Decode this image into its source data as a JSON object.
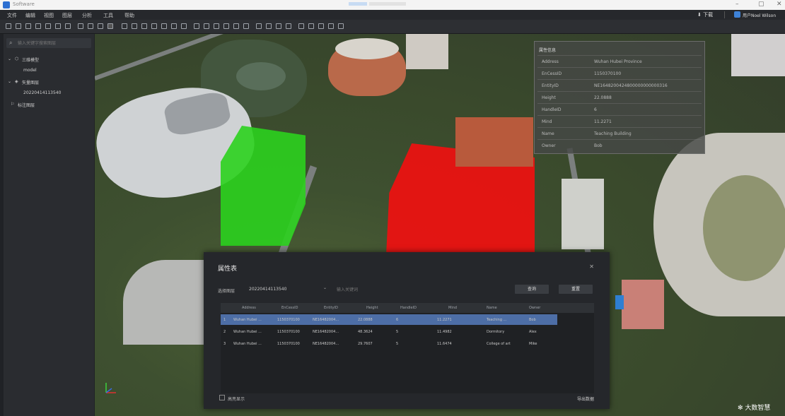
{
  "window": {
    "title": "Software"
  },
  "menu": {
    "items": [
      "文件",
      "编辑",
      "视图",
      "图层",
      "分析",
      "工具",
      "帮助"
    ],
    "right_label": "下载",
    "user": "用户Noel Wilson"
  },
  "sidebar": {
    "search_placeholder": "输入关键字搜索图层",
    "tree": [
      {
        "label": "三维模型",
        "level": 0
      },
      {
        "label": "model",
        "level": 1
      },
      {
        "label": "矢量图层",
        "level": 0
      },
      {
        "label": "20220414113540",
        "level": 1
      },
      {
        "label": "标注图层",
        "level": 0
      }
    ]
  },
  "info_popup": {
    "title": "属性信息",
    "rows": [
      {
        "key": "Address",
        "value": "Wuhan Hubei Province"
      },
      {
        "key": "EnCessID",
        "value": "1150370100"
      },
      {
        "key": "EntityID",
        "value": "NE1648200424800000000000316"
      },
      {
        "key": "Height",
        "value": "22.0888"
      },
      {
        "key": "HandleID",
        "value": "6"
      },
      {
        "key": "Mind",
        "value": "11.2271"
      },
      {
        "key": "Name",
        "value": "Teaching Building"
      },
      {
        "key": "Owner",
        "value": "Bob"
      }
    ]
  },
  "dialog": {
    "title": "属性表",
    "close": "✕",
    "filter_label": "选择图层",
    "filter_value": "20220414113540",
    "search_placeholder": "输入关键词",
    "btn_query": "查询",
    "btn_reset": "重置",
    "columns": [
      "Address",
      "EnCessID",
      "EntityID",
      "Height",
      "HandleID",
      "Mind",
      "Name",
      "Owner"
    ],
    "rows": [
      {
        "idx": "1",
        "cells": [
          "Wuhan Hubei ...",
          "1150370100",
          "NE16482004...",
          "22.0888",
          "6",
          "11.2271",
          "Teaching ...",
          "Bob"
        ]
      },
      {
        "idx": "2",
        "cells": [
          "Wuhan Hubei ...",
          "1150370100",
          "NE16482004...",
          "48.3624",
          "5",
          "11.4982",
          "Dormitory",
          "Alex"
        ]
      },
      {
        "idx": "3",
        "cells": [
          "Wuhan Hubei ...",
          "1150370100",
          "NE16482004...",
          "29.7607",
          "5",
          "11.6474",
          "College of art",
          "Mike"
        ]
      }
    ],
    "checkbox_label": "高亮显示",
    "export_label": "导出数据"
  },
  "logo": "大数智慧"
}
